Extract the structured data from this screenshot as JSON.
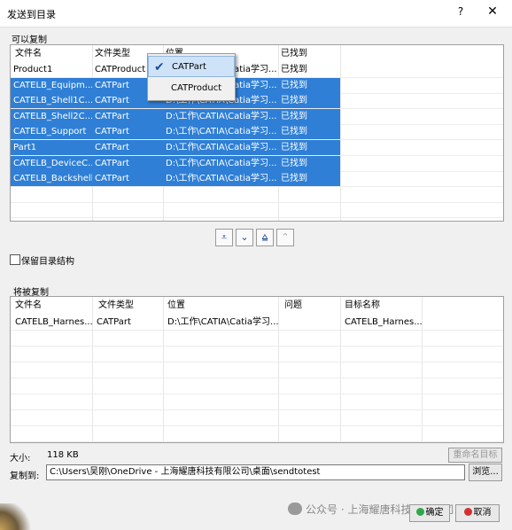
{
  "window": {
    "title": "发送到目录",
    "help": "?",
    "close": "✕"
  },
  "copyable": {
    "group_label": "可以复制",
    "headers": [
      "文件名",
      "文件类型",
      "位置",
      "已找到"
    ],
    "rows": [
      {
        "name": "Product1",
        "type": "CATProduct",
        "location": "D:\\工作\\CATIA\\Catia学习...",
        "found": "已找到",
        "selected": false
      },
      {
        "name": "CATELB_Equipm...",
        "type": "CATPart",
        "location": "D:\\工作\\CATIA\\Catia学习...",
        "found": "已找到",
        "selected": true
      },
      {
        "name": "CATELB_Shell1C...",
        "type": "CATPart",
        "location": "D:\\工作\\CATIA\\Catia学习...",
        "found": "已找到",
        "selected": true
      },
      {
        "name": "CATELB_Shell2C...",
        "type": "CATPart",
        "location": "D:\\工作\\CATIA\\Catia学习...",
        "found": "已找到",
        "selected": true
      },
      {
        "name": "CATELB_Support",
        "type": "CATPart",
        "location": "D:\\工作\\CATIA\\Catia学习...",
        "found": "已找到",
        "selected": true
      },
      {
        "name": "Part1",
        "type": "CATPart",
        "location": "D:\\工作\\CATIA\\Catia学习...",
        "found": "已找到",
        "selected": true
      },
      {
        "name": "CATELB_DeviceC...",
        "type": "CATPart",
        "location": "D:\\工作\\CATIA\\Catia学习...",
        "found": "已找到",
        "selected": true
      },
      {
        "name": "CATELB_Backshell",
        "type": "CATPart",
        "location": "D:\\工作\\CATIA\\Catia学习...",
        "found": "已找到",
        "selected": true
      }
    ]
  },
  "type_filter_popup": {
    "items": [
      {
        "label": "CATPart",
        "checked": true
      },
      {
        "label": "CATProduct",
        "checked": false
      }
    ]
  },
  "transfer_buttons": [
    "⩡",
    "⌄",
    "⩠",
    "⌃"
  ],
  "keep_structure": {
    "label": "保留目录结构",
    "checked": false
  },
  "to_copy": {
    "group_label": "将被复制",
    "headers": [
      "文件名",
      "文件类型",
      "位置",
      "问题",
      "目标名称"
    ],
    "rows": [
      {
        "name": "CATELB_Harnes...",
        "type": "CATPart",
        "location": "D:\\工作\\CATIA\\Catia学习...",
        "issue": "",
        "target": "CATELB_Harnes..."
      }
    ]
  },
  "size": {
    "label": "大小:",
    "value": "118 KB"
  },
  "rename_button": "重命名目标",
  "copy_to": {
    "label": "复制到:",
    "path": "C:\\Users\\吴刚\\OneDrive - 上海耀唐科技有限公司\\桌面\\sendtotest"
  },
  "browse_button": "浏览...",
  "ok_button": "确定",
  "cancel_button": "取消",
  "watermark": "公众号 · 上海耀唐科技有限公司"
}
